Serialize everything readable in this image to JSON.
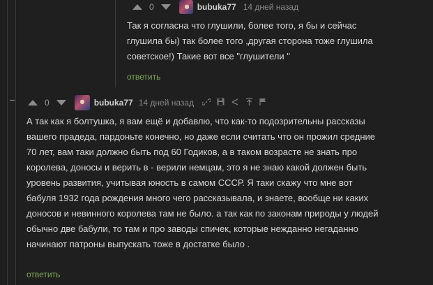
{
  "comment1": {
    "vote_count": "0",
    "username": "bubuka77",
    "time": "14 дней назад",
    "lines": [
      "Так я согласна что глушили, более того, я бы и сейчас",
      "глушила бы) так более того ,другая сторона тоже глушила",
      "советское!) Такие вот все \"глушители \""
    ],
    "reply_label": "ответить"
  },
  "comment2": {
    "vote_count": "0",
    "username": "bubuka77",
    "time": "14 дней назад",
    "lines": [
      "А так как я болтушка, я вам ещё и добавлю, что как-то подозрительны рассказы",
      "вашего прадеда, пардоньте конечно, но даже если считать что он прожил средние",
      "70 лет, вам таки должно быть под 60 Годиков, а в таком возрасте не знать про",
      "королева, доносы и верить в - верили немцам, это я не знаю какой должен быть",
      "уровень развития, учитывая юность в самом СССР. Я таки скажу что мне вот",
      "бабуля 1932 года рождения много чего рассказывала, и знаете, вообще ни каких",
      "доносов и невинного королева там не было. а так как по законам природы у людей",
      "обычно две бабули, то там и про заводы спичек, которые нежданно негаданно",
      "начинают патроны выпускать тоже в достатке было ."
    ],
    "reply_label": "ответить"
  },
  "icons": [
    "collapse-icon",
    "upvote-icon",
    "downvote-icon",
    "link-icon",
    "save-icon",
    "share-icon",
    "up-tree-icon",
    "report-icon"
  ]
}
